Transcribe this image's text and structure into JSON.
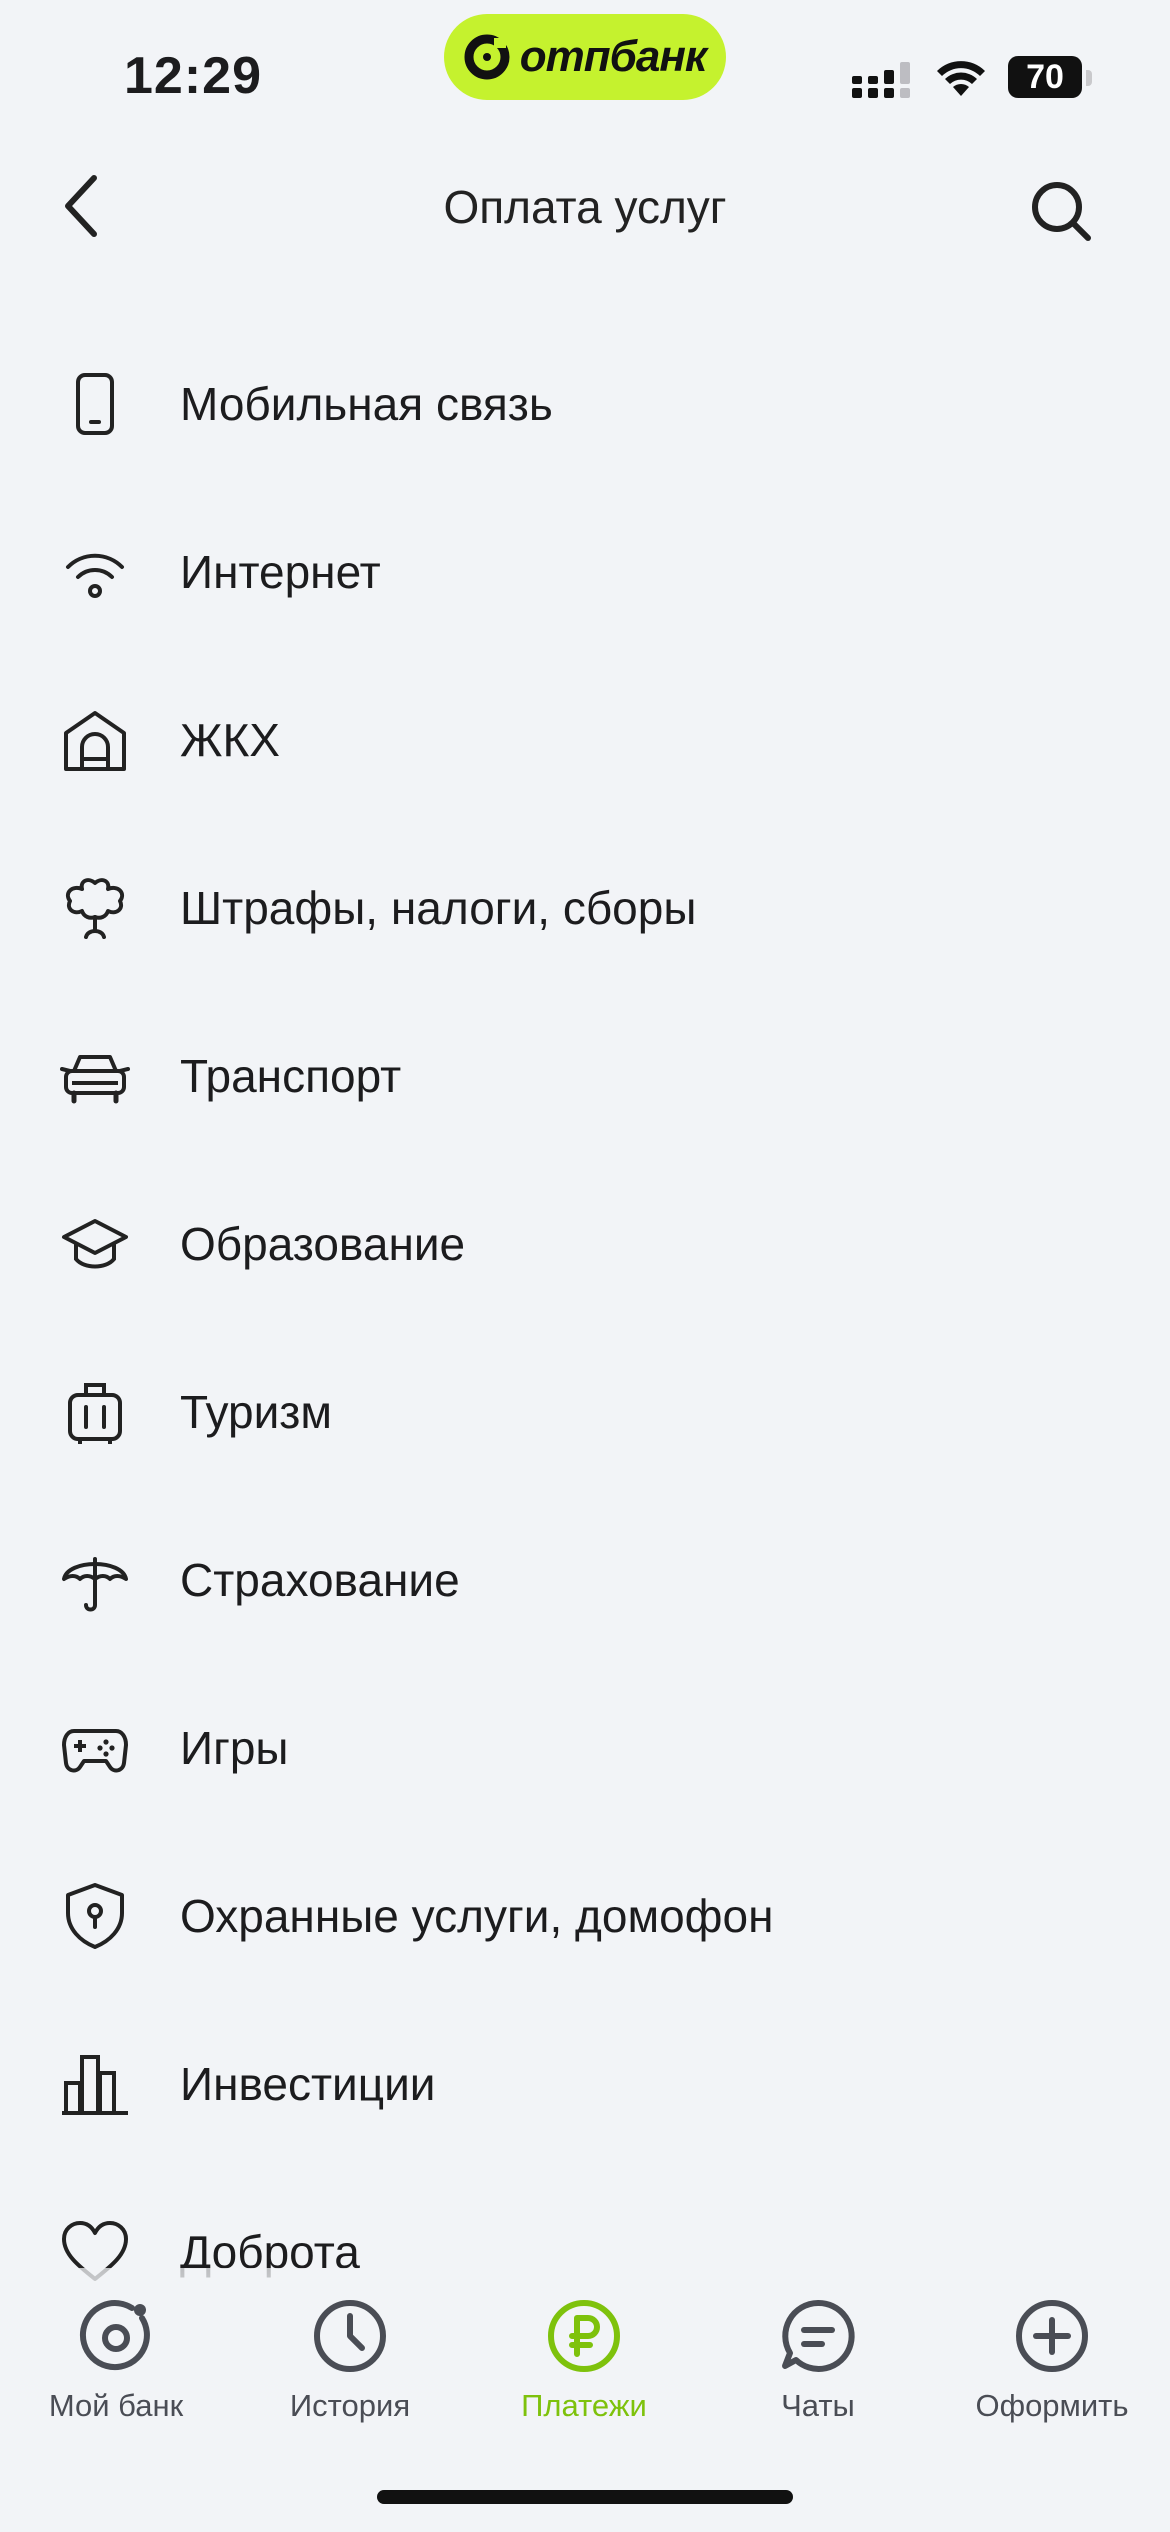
{
  "status_bar": {
    "time": "12:29",
    "bank_brand": "отпбанк",
    "battery_level": "70",
    "brand_color": "#c5f22e"
  },
  "header": {
    "title": "Оплата услуг",
    "back_icon": "chevron-left-icon",
    "search_icon": "search-icon"
  },
  "services": [
    {
      "label": "Мобильная связь",
      "icon": "mobile-phone-icon"
    },
    {
      "label": "Интернет",
      "icon": "wifi-icon"
    },
    {
      "label": "ЖКХ",
      "icon": "house-icon"
    },
    {
      "label": "Штрафы, налоги, сборы",
      "icon": "emblem-icon"
    },
    {
      "label": "Транспорт",
      "icon": "car-icon"
    },
    {
      "label": "Образование",
      "icon": "graduation-cap-icon"
    },
    {
      "label": "Туризм",
      "icon": "suitcase-icon"
    },
    {
      "label": "Страхование",
      "icon": "umbrella-icon"
    },
    {
      "label": "Игры",
      "icon": "gamepad-icon"
    },
    {
      "label": "Охранные услуги, домофон",
      "icon": "shield-icon"
    },
    {
      "label": "Инвестиции",
      "icon": "bar-chart-icon"
    },
    {
      "label": "Доброта",
      "icon": "heart-icon"
    }
  ],
  "tabbar": {
    "tabs": [
      {
        "label": "Мой банк",
        "icon": "my-bank-icon",
        "active": false
      },
      {
        "label": "История",
        "icon": "clock-icon",
        "active": false
      },
      {
        "label": "Платежи",
        "icon": "ruble-icon",
        "active": true
      },
      {
        "label": "Чаты",
        "icon": "chat-icon",
        "active": false
      },
      {
        "label": "Оформить",
        "icon": "plus-circle-icon",
        "active": false
      }
    ],
    "active_color": "#7ec20c",
    "inactive_color": "#4a4d55"
  }
}
